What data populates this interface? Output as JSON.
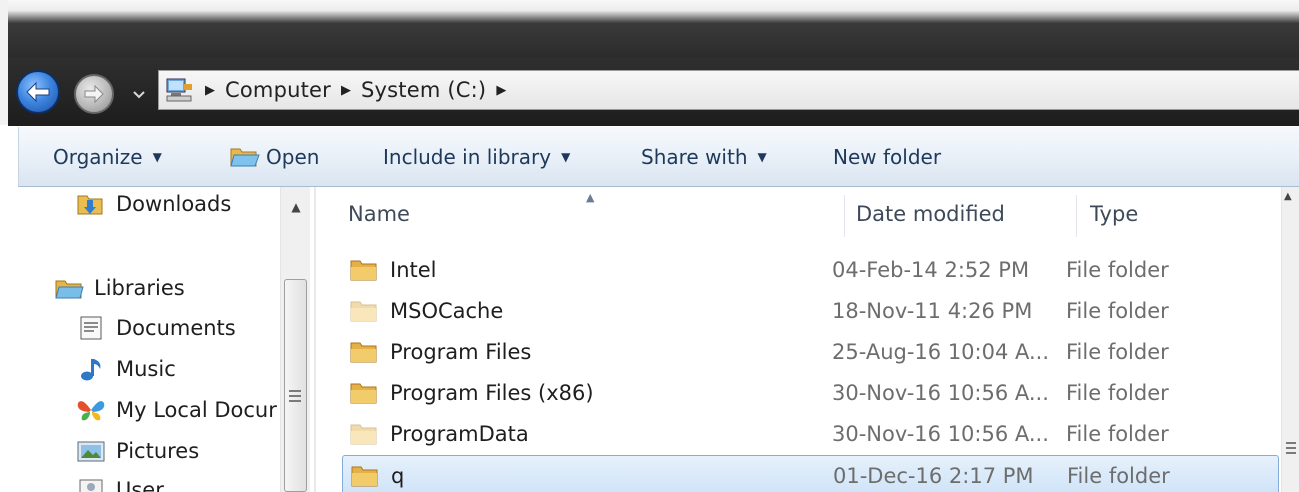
{
  "address": {
    "crumbs": [
      "Computer",
      "System (C:)"
    ]
  },
  "toolbar": {
    "organize": "Organize",
    "open": "Open",
    "include_in_library": "Include in library",
    "share_with": "Share with",
    "new_folder": "New folder"
  },
  "nav": {
    "items": [
      {
        "label": "Downloads",
        "icon": "downloads-folder-icon"
      },
      {
        "label": "Libraries",
        "icon": "libraries-icon"
      },
      {
        "label": "Documents",
        "icon": "documents-icon"
      },
      {
        "label": "Music",
        "icon": "music-note-icon"
      },
      {
        "label": "My Local Docur",
        "icon": "butterfly-icon"
      },
      {
        "label": "Pictures",
        "icon": "pictures-icon"
      },
      {
        "label": "User",
        "icon": "user-icon"
      }
    ]
  },
  "columns": {
    "name": "Name",
    "date_modified": "Date modified",
    "type": "Type"
  },
  "files": [
    {
      "name": "Intel",
      "date": "04-Feb-14 2:52 PM",
      "type": "File folder",
      "hidden": false
    },
    {
      "name": "MSOCache",
      "date": "18-Nov-11 4:26 PM",
      "type": "File folder",
      "hidden": true
    },
    {
      "name": "Program Files",
      "date": "25-Aug-16 10:04 A...",
      "type": "File folder",
      "hidden": false
    },
    {
      "name": "Program Files (x86)",
      "date": "30-Nov-16 10:56 A...",
      "type": "File folder",
      "hidden": false
    },
    {
      "name": "ProgramData",
      "date": "30-Nov-16 10:56 A...",
      "type": "File folder",
      "hidden": true
    },
    {
      "name": "q",
      "date": "01-Dec-16 2:17 PM",
      "type": "File folder",
      "hidden": false,
      "selected": true
    }
  ],
  "colors": {
    "toolbar_text": "#1e395b",
    "selection_border": "#84acdd",
    "back_button": "#3e86e0"
  }
}
